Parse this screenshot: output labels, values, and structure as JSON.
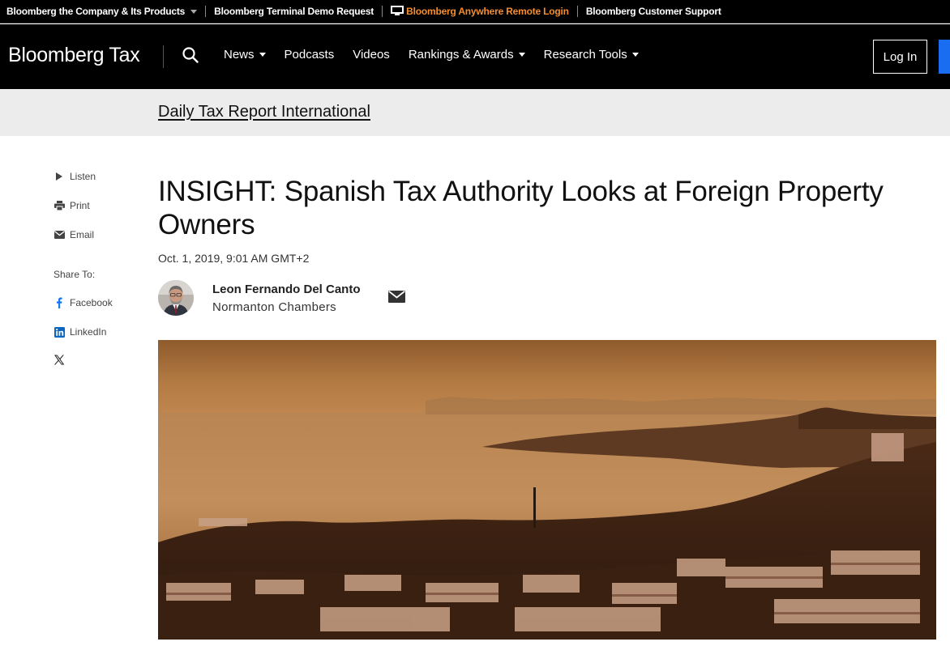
{
  "utility_bar": {
    "company_products": "Bloomberg the Company & Its Products",
    "terminal_demo": "Bloomberg Terminal Demo Request",
    "anywhere_login": "Bloomberg Anywhere Remote Login",
    "customer_support": "Bloomberg Customer Support",
    "accent_color": "#f68d2e"
  },
  "nav": {
    "logo": "Bloomberg Tax",
    "items": [
      "News",
      "Podcasts",
      "Videos",
      "Rankings & Awards",
      "Research Tools"
    ],
    "login": "Log In"
  },
  "section": {
    "title": "Daily Tax Report International"
  },
  "sidebar": {
    "listen": "Listen",
    "print": "Print",
    "email": "Email",
    "share_to": "Share To:",
    "facebook": "Facebook",
    "linkedin": "LinkedIn"
  },
  "article": {
    "headline": "INSIGHT: Spanish Tax Authority Looks at Foreign Property Owners",
    "date": "Oct. 1, 2019, 9:01 AM GMT+2",
    "author_name": "Leon Fernando Del Canto",
    "author_org": "Normanton Chambers"
  },
  "icons": {
    "search": "search-icon",
    "listen": "play-icon",
    "print": "printer-icon",
    "email": "envelope-icon",
    "facebook": "facebook-icon",
    "linkedin": "linkedin-icon",
    "x": "x-icon"
  }
}
